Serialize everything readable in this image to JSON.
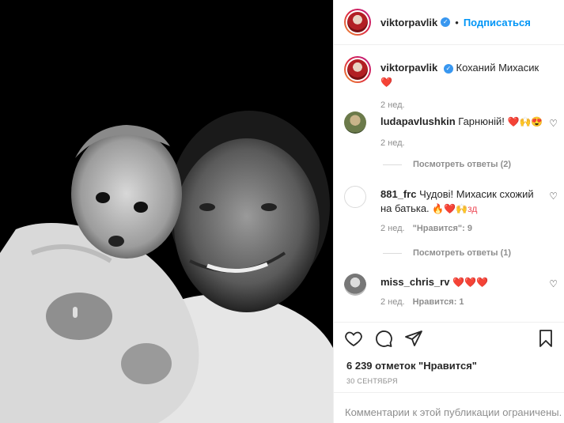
{
  "post": {
    "username": "viktorpavlik",
    "follow_label": "Подписаться",
    "dot": "•",
    "caption_text": "Коханий Михасик",
    "caption_emoji": "❤️",
    "caption_time": "2 нед."
  },
  "comments": [
    {
      "username": "ludapavlushkin",
      "text": "Гарнюній!",
      "emoji": "❤️🙌😍",
      "time": "2 нед.",
      "replies": "Посмотреть ответы (2)"
    },
    {
      "username": "881_frc",
      "text": "Чудові! Михасик схожий на батька.",
      "emoji": "🔥❤️🙌зд",
      "time": "2 нед.",
      "likes": "\"Нравится\": 9",
      "replies": "Посмотреть ответы (1)"
    },
    {
      "username": "miss_chris_rv",
      "text": "",
      "emoji": "❤️❤️❤️",
      "time": "2 нед.",
      "likes_label": "Нравится: 1"
    }
  ],
  "footer": {
    "likes": "6 239 отметок \"Нравится\"",
    "date": "30 СЕНТЯБРЯ",
    "comments_limited": "Комментарии к этой публикации ограничены."
  },
  "icons": [
    "heart-icon",
    "comment-icon",
    "share-icon",
    "bookmark-icon",
    "verified-icon"
  ]
}
